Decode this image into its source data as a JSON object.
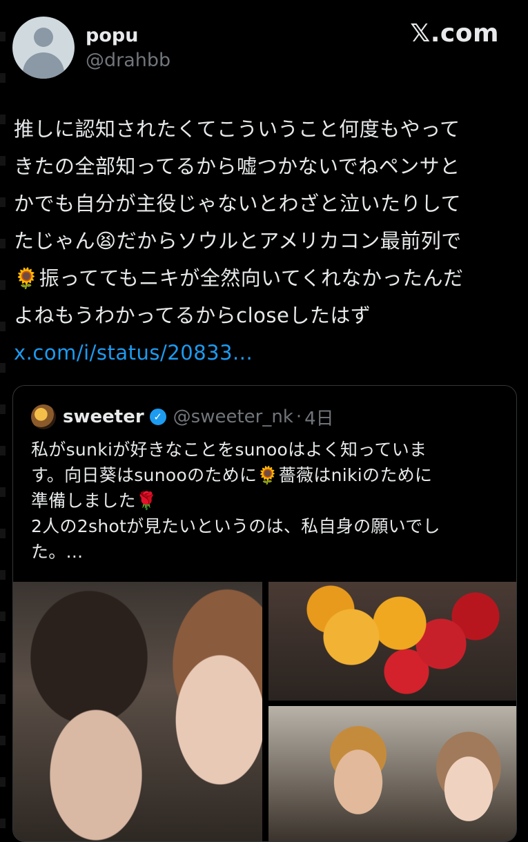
{
  "post": {
    "display_name": "popu",
    "handle": "@drahbb",
    "brand": "𝕏.com",
    "text_lines": [
      "推しに認知されたくてこういうこと何度もやって",
      "きたの全部知ってるから嘘つかないでねペンサと",
      "かでも自分が主役じゃないとわざと泣いたりして",
      "たじゃん😫だからソウルとアメリカコン最前列で",
      "🌻振っててもニキが全然向いてくれなかったんだ",
      "よねもうわかってるからcloseしたはず"
    ],
    "link": "x.com/i/status/20833..."
  },
  "quote": {
    "name": "sweeter",
    "handle": "@sweeter_nk",
    "separator": "·",
    "time": "4日",
    "text_lines": [
      "私がsunkiが好きなことをsunooはよく知っていま",
      "す。向日葵はsunooのために🌻薔薇はnikiのために",
      "準備しました🌹",
      "2人の2shotが見たいというのは、私自身の願いでし",
      "た。..."
    ]
  },
  "colors": {
    "background": "#000000",
    "text": "#e7e9ea",
    "secondary": "#71767b",
    "link": "#1d9bf0",
    "border": "#333639"
  }
}
